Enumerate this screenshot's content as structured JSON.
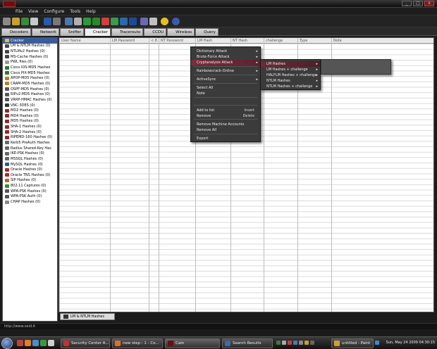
{
  "menubar": [
    "File",
    "View",
    "Configure",
    "Tools",
    "Help"
  ],
  "window_controls": {
    "minimize": "_",
    "maximize": "□",
    "close": "x"
  },
  "tabs": [
    {
      "label": "Decoders",
      "icon": "decoders-icon",
      "color": "#c8a020"
    },
    {
      "label": "Network",
      "icon": "network-icon",
      "color": "#4a8a4a"
    },
    {
      "label": "Sniffer",
      "icon": "sniffer-icon",
      "color": "#3a6ab0"
    },
    {
      "label": "Cracker",
      "icon": "cracker-icon",
      "color": "#9a6a20"
    },
    {
      "label": "Traceroute",
      "icon": "traceroute-icon",
      "color": "#2a6aaa"
    },
    {
      "label": "CCDU",
      "icon": "ccdu-icon",
      "color": "#3a9a3a"
    },
    {
      "label": "Wireless",
      "icon": "wireless-icon",
      "color": "#aa3a3a"
    },
    {
      "label": "Query",
      "icon": "query-icon",
      "color": "#6a6a9a"
    }
  ],
  "tree": {
    "root": "Cracker",
    "items": [
      {
        "label": "LM & NTLM Hashes (0)",
        "color": "#444"
      },
      {
        "label": "NTLMv2 Hashes (0)",
        "color": "#444"
      },
      {
        "label": "MS-Cache Hashes (0)",
        "color": "#444"
      },
      {
        "label": "PWL files (0)",
        "color": "#999"
      },
      {
        "label": "Cisco IOS-MD5 Hashes",
        "color": "#2a7a2a"
      },
      {
        "label": "Cisco PIX-MD5 Hashes",
        "color": "#2a7a2a"
      },
      {
        "label": "APOP-MD5 Hashes (0)",
        "color": "#b08020"
      },
      {
        "label": "CRAM-MD5 Hashes (0)",
        "color": "#b08020"
      },
      {
        "label": "OSPF-MD5 Hashes (0)",
        "color": "#555"
      },
      {
        "label": "RIPv2-MD5 Hashes (0)",
        "color": "#555"
      },
      {
        "label": "VRRP-HMAC Hashes (0)",
        "color": "#555"
      },
      {
        "label": "VNC-3DES (0)",
        "color": "#333"
      },
      {
        "label": "MD2 Hashes (0)",
        "color": "#8a2a2a"
      },
      {
        "label": "MD4 Hashes (0)",
        "color": "#8a2a2a"
      },
      {
        "label": "MD5 Hashes (0)",
        "color": "#8a2a2a"
      },
      {
        "label": "SHA-1 Hashes (0)",
        "color": "#8a2a2a"
      },
      {
        "label": "SHA-2 Hashes (0)",
        "color": "#8a2a2a"
      },
      {
        "label": "RIPEMD-160 Hashes (0)",
        "color": "#8a2a2a"
      },
      {
        "label": "Kerb5 PreAuth Hashes",
        "color": "#666"
      },
      {
        "label": "Radius Shared-Key Has",
        "color": "#666"
      },
      {
        "label": "IKE-PSK Hashes (0)",
        "color": "#666"
      },
      {
        "label": "MSSQL Hashes (0)",
        "color": "#666"
      },
      {
        "label": "MySQL Hashes (0)",
        "color": "#2a5a8a"
      },
      {
        "label": "Oracle Hashes (0)",
        "color": "#aa2a2a"
      },
      {
        "label": "Oracle TNS Hashes (0)",
        "color": "#aa2a2a"
      },
      {
        "label": "SIP Hashes (0)",
        "color": "#aa6a2a"
      },
      {
        "label": "802.11 Captures (0)",
        "color": "#3a8a3a"
      },
      {
        "label": "WPA-PSK Hashes (0)",
        "color": "#555"
      },
      {
        "label": "WPA-PSK Auth (0)",
        "color": "#555"
      },
      {
        "label": "CHAP Hashes (0)",
        "color": "#888"
      }
    ]
  },
  "grid": {
    "columns": [
      "User Name",
      "LM Password",
      "< 8",
      "NT Password",
      "LM Hash",
      "NT Hash",
      "challenge",
      "Type",
      "Note"
    ]
  },
  "context_menu": {
    "items": [
      {
        "label": "Dictionary Attack",
        "submenu": true
      },
      {
        "label": "Brute-Force Attack",
        "submenu": true
      },
      {
        "label": "Cryptanalysis Attack",
        "submenu": true,
        "highlighted": true
      },
      {
        "label": "Rainbowcrack-Online",
        "submenu": true
      },
      {
        "label": "ActiveSync",
        "submenu": true
      },
      {
        "label": "Select All",
        "submenu": false
      },
      {
        "label": "Note",
        "submenu": false
      },
      {
        "label": "Add to list",
        "shortcut": "Insert",
        "submenu": false
      },
      {
        "label": "Remove",
        "shortcut": "Delete",
        "submenu": false
      },
      {
        "label": "Remove Machine Accounts",
        "submenu": false
      },
      {
        "label": "Remove All",
        "submenu": false
      },
      {
        "label": "Export",
        "submenu": false
      }
    ]
  },
  "crypto_submenu": {
    "items": [
      {
        "label": "LM Hashes",
        "highlighted": true
      },
      {
        "label": "LM Hashes + challenge"
      },
      {
        "label": "HALFLM Hashes + challenge"
      },
      {
        "label": "NTLM Hashes"
      },
      {
        "label": "NTLM Hashes + challenge"
      }
    ]
  },
  "bottom_tab": {
    "label": "LM & NTLM Hashes"
  },
  "statusbar": {
    "text": "http://www.oxid.it"
  },
  "taskbar": {
    "tasks": [
      {
        "label": "Security Center A...",
        "color": "#c83030"
      },
      {
        "label": "new step : 1 - Co...",
        "color": "#e07020"
      },
      {
        "label": "Cain",
        "color": "#6b1010"
      },
      {
        "label": "Search Results",
        "color": "#3a6ab0"
      },
      {
        "label": "untitled - Paint",
        "color": "#d0a030"
      }
    ],
    "clock": "Sun, May 24 2009 04:30:15"
  }
}
